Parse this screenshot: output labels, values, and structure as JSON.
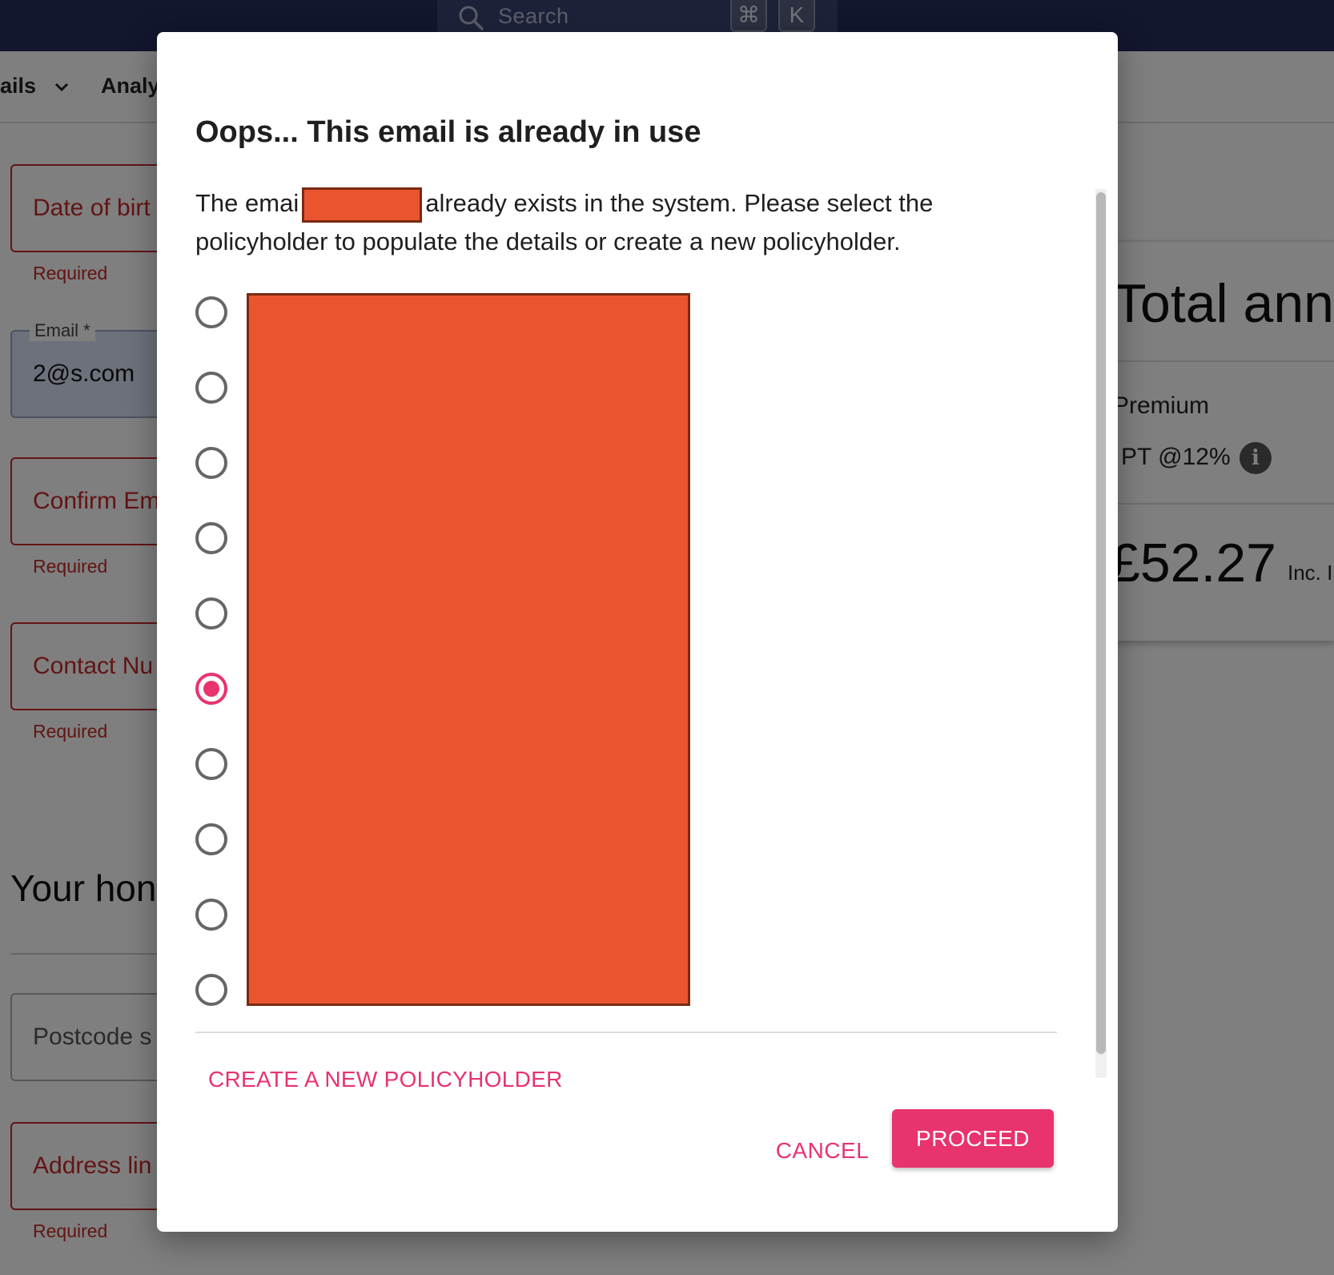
{
  "topbar": {
    "search_placeholder": "Search",
    "shortcut_modifier": "⌘",
    "shortcut_key": "K"
  },
  "nav": {
    "items": [
      {
        "label": "ails"
      },
      {
        "label": "Analy"
      }
    ]
  },
  "form": {
    "date_of_birth_label": "Date of birt",
    "date_of_birth_helper": "Required",
    "email_legend": "Email *",
    "email_value": "2@s.com",
    "confirm_email_label": "Confirm Em",
    "confirm_email_helper": "Required",
    "contact_number_label": "Contact Nu",
    "contact_number_helper": "Required",
    "home_section_title": "Your hon",
    "postcode_label": "Postcode s",
    "address_label": "Address lin",
    "address_helper": "Required"
  },
  "summary": {
    "title": "Total ann",
    "premium_label": "Premium",
    "ipt_label": "PT @12%",
    "price": "£52.27",
    "price_suffix": "Inc. I"
  },
  "dialog": {
    "title": "Oops... This email is already in use",
    "message_prefix": "The emai",
    "message_suffix": "already exists in the system. Please select the policyholder to populate the details or create a new policyholder.",
    "selected_index": 5,
    "options_count": 10,
    "create_link_label": "CREATE A NEW POLICYHOLDER",
    "cancel_label": "CANCEL",
    "proceed_label": "PROCEED",
    "accent_color": "#e8336d",
    "redaction_color": "#ea5530"
  }
}
